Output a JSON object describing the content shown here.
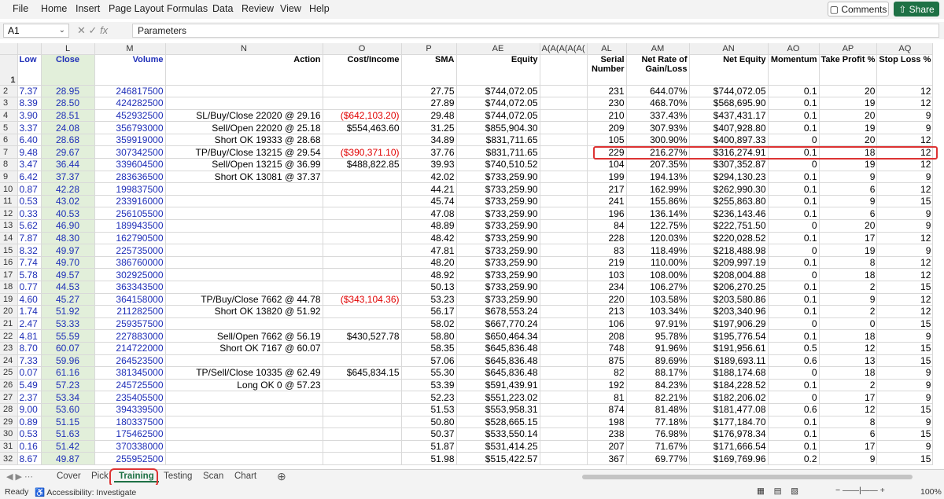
{
  "menu": [
    "File",
    "Home",
    "Insert",
    "Page Layout",
    "Formulas",
    "Data",
    "Review",
    "View",
    "Help"
  ],
  "buttons": {
    "comments": "Comments",
    "share": "Share"
  },
  "formula": {
    "namebox": "A1",
    "fx": "fx",
    "content": "Parameters"
  },
  "columns": [
    "L",
    "L",
    "M",
    "N",
    "O",
    "P",
    "AE",
    "A(A(A(A(A(",
    "AL",
    "AM",
    "AN",
    "AO",
    "AP",
    "AQ"
  ],
  "col_letters": {
    "k": "",
    "l": "L",
    "m": "M",
    "n": "N",
    "o": "O",
    "p": "P",
    "ae": "AE",
    "mid": "A(A(A(A(A(",
    "al": "AL",
    "am": "AM",
    "an": "AN",
    "ao": "AO",
    "ap": "AP",
    "aq": "AQ"
  },
  "headers": {
    "k": "Low",
    "l": "Close",
    "m": "Volume",
    "n": "Action",
    "o": "Cost/Income",
    "p": "SMA",
    "ae": "Equity",
    "al": "Serial Number",
    "am": "Net Rate of Gain/Loss",
    "an": "Net Equity",
    "ao": "Momentum",
    "ap": "Take Profit %",
    "aq": "Stop Loss %"
  },
  "rows": [
    {
      "r": "2",
      "k": "7.37",
      "l": "28.95",
      "m": "246817500",
      "n": "",
      "o": "",
      "p": "27.75",
      "ae": "$744,072.05",
      "al": "231",
      "am": "644.07%",
      "an": "$744,072.05",
      "ao": "0.1",
      "ap": "20",
      "aq": "12"
    },
    {
      "r": "3",
      "k": "8.39",
      "l": "28.50",
      "m": "424282500",
      "n": "",
      "o": "",
      "p": "27.89",
      "ae": "$744,072.05",
      "al": "230",
      "am": "468.70%",
      "an": "$568,695.90",
      "ao": "0.1",
      "ap": "19",
      "aq": "12"
    },
    {
      "r": "4",
      "k": "3.90",
      "l": "28.51",
      "m": "452932500",
      "n": "SL/Buy/Close 22020 @ 29.16",
      "o": "($642,103.20)",
      "p": "29.48",
      "ae": "$744,072.05",
      "al": "210",
      "am": "337.43%",
      "an": "$437,431.17",
      "ao": "0.1",
      "ap": "20",
      "aq": "9"
    },
    {
      "r": "5",
      "k": "3.37",
      "l": "24.08",
      "m": "356793000",
      "n": "Sell/Open 22020 @ 25.18",
      "o": "$554,463.60",
      "p": "31.25",
      "ae": "$855,904.30",
      "al": "209",
      "am": "307.93%",
      "an": "$407,928.80",
      "ao": "0.1",
      "ap": "19",
      "aq": "9"
    },
    {
      "r": "6",
      "k": "6.40",
      "l": "28.68",
      "m": "359919000",
      "n": "Short OK 19333 @ 28.68",
      "o": "",
      "p": "34.89",
      "ae": "$831,711.65",
      "al": "105",
      "am": "300.90%",
      "an": "$400,897.33",
      "ao": "0",
      "ap": "20",
      "aq": "12"
    },
    {
      "r": "7",
      "k": "9.48",
      "l": "29.67",
      "m": "307342500",
      "n": "TP/Buy/Close 13215 @ 29.54",
      "o": "($390,371.10)",
      "p": "37.76",
      "ae": "$831,711.65",
      "al": "229",
      "am": "216.27%",
      "an": "$316,274.91",
      "ao": "0.1",
      "ap": "18",
      "aq": "12"
    },
    {
      "r": "8",
      "k": "3.47",
      "l": "36.44",
      "m": "339604500",
      "n": "Sell/Open 13215 @ 36.99",
      "o": "$488,822.85",
      "p": "39.93",
      "ae": "$740,510.52",
      "al": "104",
      "am": "207.35%",
      "an": "$307,352.87",
      "ao": "0",
      "ap": "19",
      "aq": "12"
    },
    {
      "r": "9",
      "k": "6.42",
      "l": "37.37",
      "m": "283636500",
      "n": "Short OK 13081 @ 37.37",
      "o": "",
      "p": "42.02",
      "ae": "$733,259.90",
      "al": "199",
      "am": "194.13%",
      "an": "$294,130.23",
      "ao": "0.1",
      "ap": "9",
      "aq": "9"
    },
    {
      "r": "10",
      "k": "0.87",
      "l": "42.28",
      "m": "199837500",
      "n": "",
      "o": "",
      "p": "44.21",
      "ae": "$733,259.90",
      "al": "217",
      "am": "162.99%",
      "an": "$262,990.30",
      "ao": "0.1",
      "ap": "6",
      "aq": "12"
    },
    {
      "r": "11",
      "k": "0.53",
      "l": "43.02",
      "m": "233916000",
      "n": "",
      "o": "",
      "p": "45.74",
      "ae": "$733,259.90",
      "al": "241",
      "am": "155.86%",
      "an": "$255,863.80",
      "ao": "0.1",
      "ap": "9",
      "aq": "15"
    },
    {
      "r": "12",
      "k": "0.33",
      "l": "40.53",
      "m": "256105500",
      "n": "",
      "o": "",
      "p": "47.08",
      "ae": "$733,259.90",
      "al": "196",
      "am": "136.14%",
      "an": "$236,143.46",
      "ao": "0.1",
      "ap": "6",
      "aq": "9"
    },
    {
      "r": "13",
      "k": "5.62",
      "l": "46.90",
      "m": "189943500",
      "n": "",
      "o": "",
      "p": "48.89",
      "ae": "$733,259.90",
      "al": "84",
      "am": "122.75%",
      "an": "$222,751.50",
      "ao": "0",
      "ap": "20",
      "aq": "9"
    },
    {
      "r": "14",
      "k": "7.87",
      "l": "48.30",
      "m": "162790500",
      "n": "",
      "o": "",
      "p": "48.42",
      "ae": "$733,259.90",
      "al": "228",
      "am": "120.03%",
      "an": "$220,028.52",
      "ao": "0.1",
      "ap": "17",
      "aq": "12"
    },
    {
      "r": "15",
      "k": "8.32",
      "l": "49.97",
      "m": "225735000",
      "n": "",
      "o": "",
      "p": "47.81",
      "ae": "$733,259.90",
      "al": "83",
      "am": "118.49%",
      "an": "$218,488.98",
      "ao": "0",
      "ap": "19",
      "aq": "9"
    },
    {
      "r": "16",
      "k": "7.74",
      "l": "49.70",
      "m": "386760000",
      "n": "",
      "o": "",
      "p": "48.20",
      "ae": "$733,259.90",
      "al": "219",
      "am": "110.00%",
      "an": "$209,997.19",
      "ao": "0.1",
      "ap": "8",
      "aq": "12"
    },
    {
      "r": "17",
      "k": "5.78",
      "l": "49.57",
      "m": "302925000",
      "n": "",
      "o": "",
      "p": "48.92",
      "ae": "$733,259.90",
      "al": "103",
      "am": "108.00%",
      "an": "$208,004.88",
      "ao": "0",
      "ap": "18",
      "aq": "12"
    },
    {
      "r": "18",
      "k": "0.77",
      "l": "44.53",
      "m": "363343500",
      "n": "",
      "o": "",
      "p": "50.13",
      "ae": "$733,259.90",
      "al": "234",
      "am": "106.27%",
      "an": "$206,270.25",
      "ao": "0.1",
      "ap": "2",
      "aq": "15"
    },
    {
      "r": "19",
      "k": "4.60",
      "l": "45.27",
      "m": "364158000",
      "n": "TP/Buy/Close 7662 @ 44.78",
      "o": "($343,104.36)",
      "p": "53.23",
      "ae": "$733,259.90",
      "al": "220",
      "am": "103.58%",
      "an": "$203,580.86",
      "ao": "0.1",
      "ap": "9",
      "aq": "12"
    },
    {
      "r": "20",
      "k": "1.74",
      "l": "51.92",
      "m": "211282500",
      "n": "Short OK 13820 @ 51.92",
      "o": "",
      "p": "56.17",
      "ae": "$678,553.24",
      "al": "213",
      "am": "103.34%",
      "an": "$203,340.96",
      "ao": "0.1",
      "ap": "2",
      "aq": "12"
    },
    {
      "r": "21",
      "k": "2.47",
      "l": "53.33",
      "m": "259357500",
      "n": "",
      "o": "",
      "p": "58.02",
      "ae": "$667,770.24",
      "al": "106",
      "am": "97.91%",
      "an": "$197,906.29",
      "ao": "0",
      "ap": "0",
      "aq": "15"
    },
    {
      "r": "22",
      "k": "4.81",
      "l": "55.59",
      "m": "227883000",
      "n": "Sell/Open 7662 @ 56.19",
      "o": "$430,527.78",
      "p": "58.80",
      "ae": "$650,464.34",
      "al": "208",
      "am": "95.78%",
      "an": "$195,776.54",
      "ao": "0.1",
      "ap": "18",
      "aq": "9"
    },
    {
      "r": "23",
      "k": "8.70",
      "l": "60.07",
      "m": "214722000",
      "n": "Short OK 7167 @ 60.07",
      "o": "",
      "p": "58.35",
      "ae": "$645,836.48",
      "al": "748",
      "am": "91.96%",
      "an": "$191,956.61",
      "ao": "0.5",
      "ap": "12",
      "aq": "15"
    },
    {
      "r": "24",
      "k": "7.33",
      "l": "59.96",
      "m": "264523500",
      "n": "",
      "o": "",
      "p": "57.06",
      "ae": "$645,836.48",
      "al": "875",
      "am": "89.69%",
      "an": "$189,693.11",
      "ao": "0.6",
      "ap": "13",
      "aq": "15"
    },
    {
      "r": "25",
      "k": "0.07",
      "l": "61.16",
      "m": "381345000",
      "n": "TP/Sell/Close 10335 @ 62.49",
      "o": "$645,834.15",
      "p": "55.30",
      "ae": "$645,836.48",
      "al": "82",
      "am": "88.17%",
      "an": "$188,174.68",
      "ao": "0",
      "ap": "18",
      "aq": "9"
    },
    {
      "r": "26",
      "k": "5.49",
      "l": "57.23",
      "m": "245725500",
      "n": "Long OK 0 @ 57.23",
      "o": "",
      "p": "53.39",
      "ae": "$591,439.91",
      "al": "192",
      "am": "84.23%",
      "an": "$184,228.52",
      "ao": "0.1",
      "ap": "2",
      "aq": "9"
    },
    {
      "r": "27",
      "k": "2.37",
      "l": "53.34",
      "m": "235405500",
      "n": "",
      "o": "",
      "p": "52.23",
      "ae": "$551,223.02",
      "al": "81",
      "am": "82.21%",
      "an": "$182,206.02",
      "ao": "0",
      "ap": "17",
      "aq": "9"
    },
    {
      "r": "28",
      "k": "9.00",
      "l": "53.60",
      "m": "394339500",
      "n": "",
      "o": "",
      "p": "51.53",
      "ae": "$553,958.31",
      "al": "874",
      "am": "81.48%",
      "an": "$181,477.08",
      "ao": "0.6",
      "ap": "12",
      "aq": "15"
    },
    {
      "r": "29",
      "k": "0.89",
      "l": "51.15",
      "m": "180337500",
      "n": "",
      "o": "",
      "p": "50.80",
      "ae": "$528,665.15",
      "al": "198",
      "am": "77.18%",
      "an": "$177,184.70",
      "ao": "0.1",
      "ap": "8",
      "aq": "9"
    },
    {
      "r": "30",
      "k": "0.53",
      "l": "51.63",
      "m": "175462500",
      "n": "",
      "o": "",
      "p": "50.37",
      "ae": "$533,550.14",
      "al": "238",
      "am": "76.98%",
      "an": "$176,978.34",
      "ao": "0.1",
      "ap": "6",
      "aq": "15"
    },
    {
      "r": "31",
      "k": "0.16",
      "l": "51.42",
      "m": "370338000",
      "n": "",
      "o": "",
      "p": "51.87",
      "ae": "$531,414.25",
      "al": "207",
      "am": "71.67%",
      "an": "$171,666.54",
      "ao": "0.1",
      "ap": "17",
      "aq": "9"
    },
    {
      "r": "32",
      "k": "8.67",
      "l": "49.87",
      "m": "255952500",
      "n": "",
      "o": "",
      "p": "51.98",
      "ae": "$515,422.57",
      "al": "367",
      "am": "69.77%",
      "an": "$169,769.96",
      "ao": "0.2",
      "ap": "9",
      "aq": "15"
    }
  ],
  "tabs": [
    "Cover",
    "Pick",
    "Training",
    "Testing",
    "Scan",
    "Chart"
  ],
  "active_tab": "Training",
  "status": {
    "ready": "Ready",
    "accessibility": "Accessibility: Investigate",
    "zoom": "100%"
  }
}
